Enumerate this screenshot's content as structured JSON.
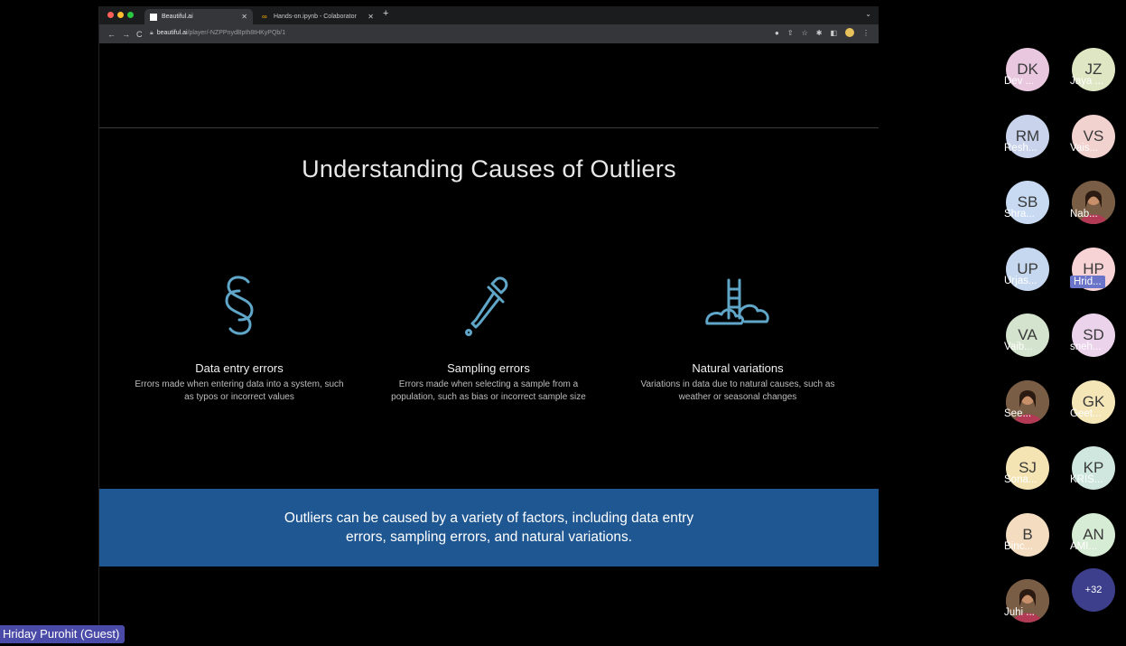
{
  "browser": {
    "tabs": [
      {
        "title": "Beautiful.ai",
        "active": true
      },
      {
        "title": "Hands-on.ipynb - Colaborator",
        "active": false
      }
    ],
    "url_host": "beautiful.ai",
    "url_path": "/player/-NZPPnydBpth8tHKyPQb/1"
  },
  "slide": {
    "title": "Understanding Causes of Outliers",
    "columns": [
      {
        "icon": "section-sign-icon",
        "title": "Data entry errors",
        "desc": "Errors made when entering data into a system, such as typos or incorrect values"
      },
      {
        "icon": "dropper-icon",
        "title": "Sampling errors",
        "desc": "Errors made when selecting a sample from a population, such as bias or incorrect sample size"
      },
      {
        "icon": "bridge-clouds-icon",
        "title": "Natural variations",
        "desc": "Variations in data due to natural causes, such as weather or seasonal changes"
      }
    ],
    "banner": "Outliers can be caused by a variety of factors, including data entry errors, sampling errors, and natural variations."
  },
  "participants": [
    {
      "initials": "DK",
      "name": "Dev ...",
      "color": "#e9c7df"
    },
    {
      "initials": "JZ",
      "name": "Jaya ...",
      "color": "#dfe6c3"
    },
    {
      "initials": "RM",
      "name": "Resh...",
      "color": "#c9d3ec"
    },
    {
      "initials": "VS",
      "name": "Vais...",
      "color": "#f1d2cf"
    },
    {
      "initials": "SB",
      "name": "Shra...",
      "color": "#c7daf2"
    },
    {
      "initials": "",
      "name": "Nab...",
      "color": "",
      "photo": true
    },
    {
      "initials": "UP",
      "name": "Urjas...",
      "color": "#c6d8f0"
    },
    {
      "initials": "HP",
      "name": "Hrid...",
      "color": "#f7d3d6",
      "highlight": true
    },
    {
      "initials": "VA",
      "name": "Vaib...",
      "color": "#d4e3cd"
    },
    {
      "initials": "SD",
      "name": "sneh...",
      "color": "#ecd3ec"
    },
    {
      "initials": "",
      "name": "See...",
      "color": "",
      "photo": true
    },
    {
      "initials": "GK",
      "name": "Geet...",
      "color": "#f5e6b8"
    },
    {
      "initials": "SJ",
      "name": "Sona...",
      "color": "#f5e4b3"
    },
    {
      "initials": "KP",
      "name": "KRIS...",
      "color": "#cfe7df"
    },
    {
      "initials": "B",
      "name": "Binc...",
      "color": "#f3dcc0"
    },
    {
      "initials": "AN",
      "name": "AMI...",
      "color": "#d7ecd4"
    },
    {
      "initials": "",
      "name": "Juhi ...",
      "color": "",
      "photo": true
    }
  ],
  "more_count": "+32",
  "speaker_label": "Hriday Purohit  (Guest)"
}
